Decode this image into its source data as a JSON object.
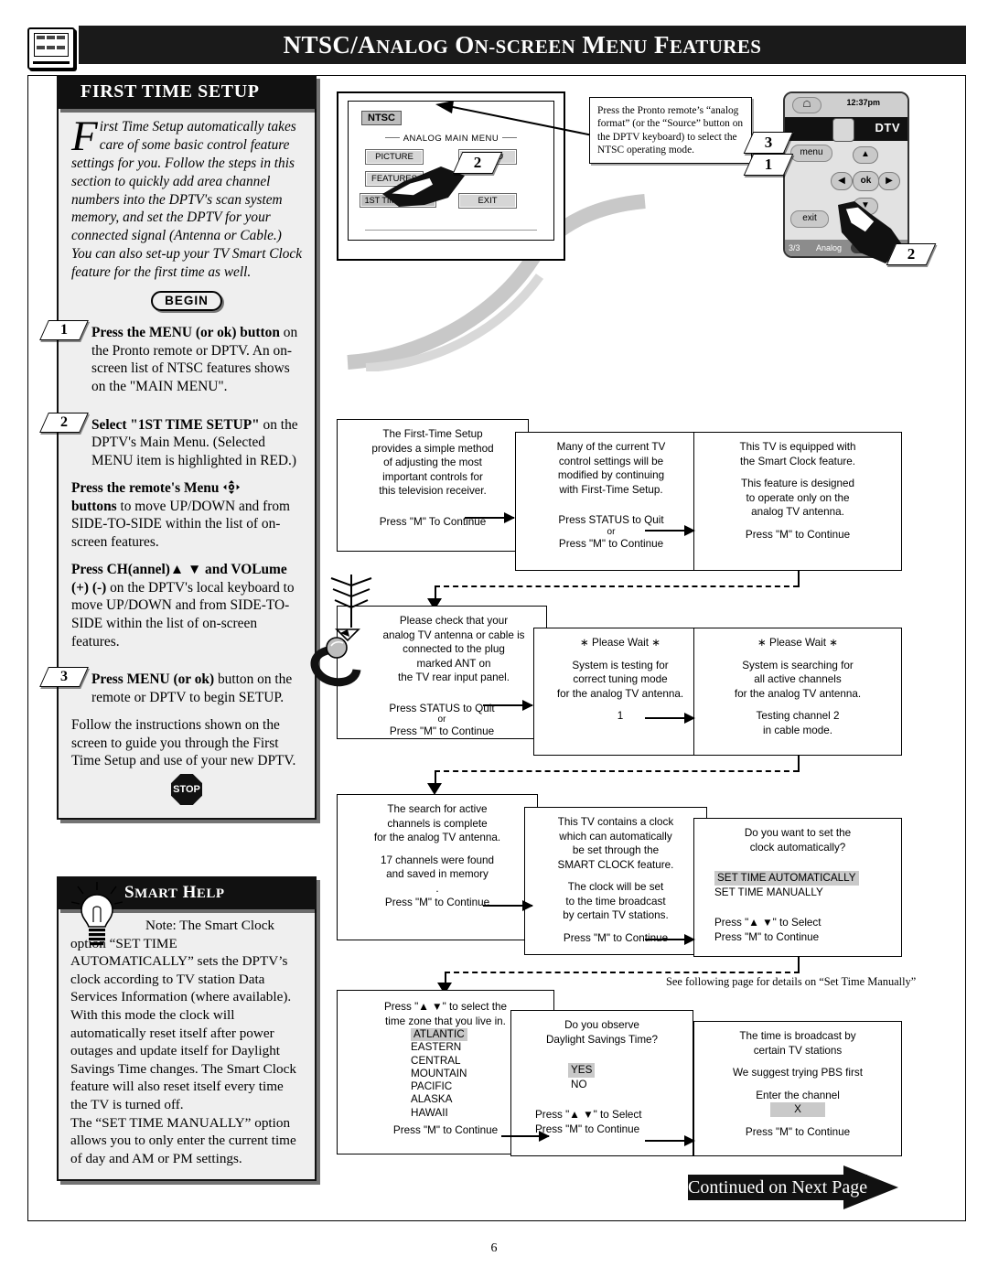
{
  "header": {
    "title_parts": [
      "NTSC/A",
      "NALOG",
      " O",
      "N-SCREEN",
      " M",
      "ENU",
      " F",
      "EATURES"
    ],
    "title": "NTSC/Analog On-screen Menu Features",
    "icon": "tv-menu-icon"
  },
  "first_time_setup": {
    "title": "FIRST TIME SETUP",
    "dropcap": "F",
    "intro": "irst Time Setup automatically takes care of some basic control feature settings for you. Follow the steps in this section to quickly add area channel numbers into the DPTV's scan system memory, and set the DPTV for your connected signal  (Antenna or Cable.) You can also set-up your TV Smart Clock feature for the first time as well.",
    "begin_label": "BEGIN",
    "steps": [
      {
        "num": "1",
        "bold": "Press the MENU (or ok) button",
        "rest": " on the Pronto remote or DPTV. An on-screen list of NTSC features shows on the \"MAIN MENU\"."
      },
      {
        "num": "2",
        "bold": "Select \"1ST TIME SETUP\"",
        "rest": " on the DPTV's Main Menu. (Selected MENU item is highlighted in RED.)"
      },
      {
        "num": "3",
        "bold": "Press MENU (or ok)",
        "rest": " button on the remote or DPTV to begin SETUP."
      }
    ],
    "para_menu_bold": "Press the remote's Menu",
    "para_menu_bold2": "buttons",
    "para_menu_rest": " to move UP/DOWN and from SIDE-TO-SIDE within the list of on-screen features.",
    "para_ch_bold": "Press CH(annel)▲ ▼ and VOLume (+) (-)",
    "para_ch_rest": " on the DPTV's local keyboard to move UP/DOWN and from SIDE-TO-SIDE within the list of on-screen features.",
    "para_follow": "Follow the instructions shown on the screen to guide you through the First Time Setup and use of your new DPTV.",
    "stop_label": "STOP"
  },
  "smart_help": {
    "title_parts": [
      "S",
      "MART",
      " H",
      "ELP"
    ],
    "title": "Smart Help",
    "icon": "lightbulb-icon",
    "body": "Note: The Smart Clock option “SET TIME AUTOMATICALLY” sets the DPTV’s clock according to TV station Data Services Information (where available). With this mode the clock will automatically reset itself after power outages and update itself for Daylight Savings Time changes. The Smart Clock feature will also reset itself every time the TV is turned off.",
    "body2": "The “SET TIME MANUALLY” option allows you to only enter the current time of day and AM or PM settings."
  },
  "tv_illustration": {
    "ntsc_badge": "NTSC",
    "menu_title": "ANALOG MAIN MENU",
    "buttons": [
      {
        "label": "PICTURE",
        "highlighted": false
      },
      {
        "label": "FEATURES",
        "highlighted": false
      },
      {
        "label": "1ST TIME SETUP",
        "highlighted": true
      },
      {
        "label": "SOUND",
        "highlighted": false
      },
      {
        "label": "EXIT",
        "highlighted": false
      }
    ],
    "callout_number": "2"
  },
  "callout": {
    "text": "Press the Pronto remote’s “analog format” (or the “Source” button on the DPTV keyboard) to select the NTSC operating mode.",
    "numbers": [
      "3",
      "1"
    ]
  },
  "pronto": {
    "time": "12:37pm",
    "mode_label": "DTV",
    "menu_label": "menu",
    "exit_label": "exit",
    "ok_label": "ok",
    "up": "▲",
    "down": "▼",
    "left": "◀",
    "right": "▶",
    "status_left": "3/3",
    "status_mid": "Analog",
    "status_right": "DTV",
    "callout_number": "2"
  },
  "flow": {
    "b1": {
      "lines": [
        "The First-Time Setup",
        "provides a simple method",
        "of adjusting the most",
        "important controls for",
        "this television receiver."
      ],
      "footer": [
        "Press \"M\" To Continue"
      ]
    },
    "b2": {
      "lines": [
        "Many of the current TV",
        "control settings will be",
        "modified by continuing",
        "with First-Time Setup."
      ],
      "footer": [
        "Press STATUS to Quit",
        "or",
        "Press \"M\" to Continue"
      ]
    },
    "b3": {
      "lines": [
        "This TV is equipped with",
        "the Smart Clock feature.",
        "",
        "This feature is designed",
        "to operate only on the",
        "analog TV antenna."
      ],
      "footer": [
        "Press \"M\" to Continue"
      ]
    },
    "b4": {
      "lines": [
        "Please check that your",
        "analog TV antenna or cable is",
        "connected to the plug",
        "marked ANT on",
        "the TV rear input panel."
      ],
      "footer": [
        "Press STATUS to Quit",
        "or",
        "Press \"M\" to Continue"
      ]
    },
    "b5": {
      "title": "∗ Please Wait ∗",
      "lines": [
        "System is testing for",
        "correct tuning mode",
        "for the analog TV antenna.",
        "",
        "1"
      ],
      "footer": []
    },
    "b6": {
      "title": "∗ Please Wait ∗",
      "lines": [
        "System is searching for",
        "all active channels",
        "for the analog TV antenna.",
        "",
        "Testing channel 2",
        "in cable mode."
      ],
      "footer": []
    },
    "b7": {
      "lines": [
        "The search for active",
        "channels is complete",
        "for the analog TV antenna.",
        "",
        "17 channels were found",
        "and saved in memory",
        "."
      ],
      "footer": [
        "Press \"M\" to Continue"
      ]
    },
    "b8": {
      "lines": [
        "This TV contains a clock",
        "which can automatically",
        "be set through the",
        "SMART CLOCK feature.",
        "",
        "The clock will be set",
        "to the time broadcast",
        "by certain TV stations."
      ],
      "footer": [
        "Press \"M\" to Continue"
      ]
    },
    "b9": {
      "lines": [
        "Do you want to set the",
        "clock automatically?"
      ],
      "options": [
        "SET TIME AUTOMATICALLY",
        "SET TIME MANUALLY"
      ],
      "selected": "SET TIME AUTOMATICALLY",
      "footer": [
        "Press  \"▲ ▼\" to Select",
        "Press \"M\" to Continue"
      ]
    },
    "b10": {
      "lines": [
        "Press  \"▲ ▼\" to select the",
        "time zone that you live in."
      ],
      "options": [
        "ATLANTIC",
        "EASTERN",
        "CENTRAL",
        "MOUNTAIN",
        "PACIFIC",
        "ALASKA",
        "HAWAII"
      ],
      "selected": "ATLANTIC",
      "footer": [
        "Press \"M\" to Continue"
      ]
    },
    "b11": {
      "lines": [
        "Do you observe",
        "Daylight Savings Time?"
      ],
      "options": [
        "YES",
        "NO"
      ],
      "selected": "YES",
      "footer": [
        "Press  \"▲ ▼\" to Select",
        "Press \"M\" to Continue"
      ]
    },
    "b12": {
      "lines": [
        "The time is broadcast by",
        "certain TV stations",
        "",
        "We suggest trying PBS first",
        "",
        "Enter the channel"
      ],
      "value": "X",
      "footer": [
        "Press \"M\" to Continue"
      ]
    }
  },
  "see_note": "See following page for details on “Set Time Manually”",
  "continued": "Continued on Next Page",
  "page_number": "6"
}
